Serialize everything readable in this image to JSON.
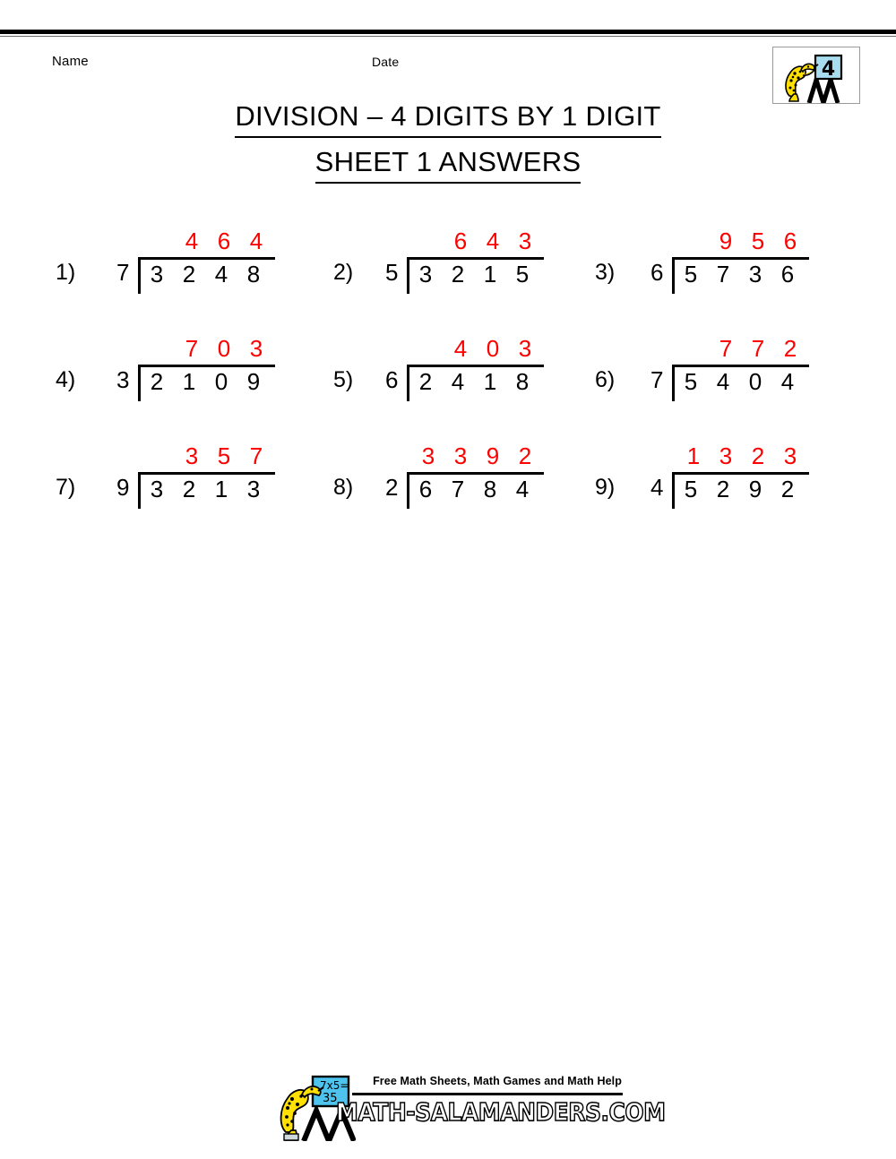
{
  "header": {
    "name_label": "Name",
    "date_label": "Date",
    "title_line1": "DIVISION – 4 DIGITS BY 1 DIGIT",
    "title_line2": "SHEET 1 ANSWERS",
    "logo": {
      "name": "math-salamanders-grade-logo",
      "board_text": "4",
      "board_color": "#a8dcef",
      "salamander_color": "#ffe000"
    }
  },
  "answer_color": "#ff0000",
  "problems": [
    {
      "index": "1)",
      "divisor": "7",
      "dividend": [
        "3",
        "2",
        "4",
        "8"
      ],
      "quotient": [
        "4",
        "6",
        "4"
      ]
    },
    {
      "index": "2)",
      "divisor": "5",
      "dividend": [
        "3",
        "2",
        "1",
        "5"
      ],
      "quotient": [
        "6",
        "4",
        "3"
      ]
    },
    {
      "index": "3)",
      "divisor": "6",
      "dividend": [
        "5",
        "7",
        "3",
        "6"
      ],
      "quotient": [
        "9",
        "5",
        "6"
      ]
    },
    {
      "index": "4)",
      "divisor": "3",
      "dividend": [
        "2",
        "1",
        "0",
        "9"
      ],
      "quotient": [
        "7",
        "0",
        "3"
      ]
    },
    {
      "index": "5)",
      "divisor": "6",
      "dividend": [
        "2",
        "4",
        "1",
        "8"
      ],
      "quotient": [
        "4",
        "0",
        "3"
      ]
    },
    {
      "index": "6)",
      "divisor": "7",
      "dividend": [
        "5",
        "4",
        "0",
        "4"
      ],
      "quotient": [
        "7",
        "7",
        "2"
      ]
    },
    {
      "index": "7)",
      "divisor": "9",
      "dividend": [
        "3",
        "2",
        "1",
        "3"
      ],
      "quotient": [
        "3",
        "5",
        "7"
      ]
    },
    {
      "index": "8)",
      "divisor": "2",
      "dividend": [
        "6",
        "7",
        "8",
        "4"
      ],
      "quotient": [
        "3",
        "3",
        "9",
        "2"
      ]
    },
    {
      "index": "9)",
      "divisor": "4",
      "dividend": [
        "5",
        "2",
        "9",
        "2"
      ],
      "quotient": [
        "1",
        "3",
        "2",
        "3"
      ]
    }
  ],
  "footer": {
    "tagline": "Free Math Sheets, Math Games and Math Help",
    "domain": "MATH-SALAMANDERS.COM",
    "logo": {
      "name": "math-salamanders-footer-logo",
      "board_text_top": "7x5=",
      "board_text_bottom": "35",
      "board_color": "#4ec3ee",
      "salamander_color": "#ffe000"
    }
  }
}
